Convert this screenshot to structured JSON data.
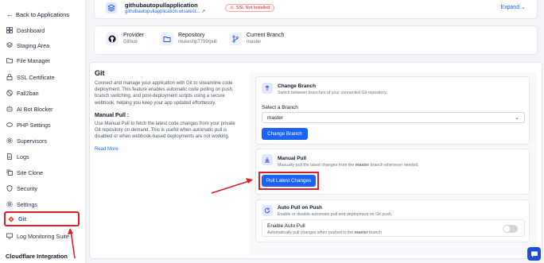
{
  "sidebar": {
    "back_label": "Back to Applications",
    "items": [
      {
        "label": "Dashboard",
        "icon": "dashboard-icon"
      },
      {
        "label": "Staging Area",
        "icon": "layers-icon"
      },
      {
        "label": "File Manager",
        "icon": "folder-icon"
      },
      {
        "label": "SSL Certificate",
        "icon": "lock-icon"
      },
      {
        "label": "Fail2ban",
        "icon": "ban-icon"
      },
      {
        "label": "AI Bot Blocker",
        "icon": "robot-icon"
      },
      {
        "label": "PHP Settings",
        "icon": "php-icon"
      },
      {
        "label": "Supervisors",
        "icon": "gear-icon"
      },
      {
        "label": "Logs",
        "icon": "document-icon"
      },
      {
        "label": "Site Clone",
        "icon": "copy-icon"
      },
      {
        "label": "Security",
        "icon": "shield-icon"
      },
      {
        "label": "Settings",
        "icon": "gear-icon"
      },
      {
        "label": "Git",
        "icon": "git-icon",
        "active": true
      },
      {
        "label": "Log Monitoring Suite",
        "icon": "monitor-icon"
      }
    ],
    "footer_label": "Cloudflare Integration"
  },
  "app": {
    "name": "githubautopullapplication",
    "url": "githubautopullapplication.wlsatest...",
    "ssl_badge": "SSL Not Installed",
    "expand_label": "Expand"
  },
  "repo": {
    "provider_label": "Provider",
    "provider_value": "Github",
    "repository_label": "Repository",
    "repository_value": "mukeshp7799/pull",
    "branch_label": "Current Branch",
    "branch_value": "master"
  },
  "git": {
    "title": "Git",
    "description": "Connect and manage your application with Git to streamline code deployment. This feature enables automatic code pulling on push, branch switching, and post-deployment scripts using a secure webhook, helping you keep your app updated effortlessly.",
    "manual_title": "Manual Pull :",
    "manual_description": "Use Manual Pull to fetch the latest code changes from your private Git repository on demand. This is useful when automatic pull is disabled or when webhook-based deployments are not working.",
    "read_more": "Read More"
  },
  "change_branch": {
    "title": "Change Branch",
    "subtitle": "Switch between branches of your connected Git repository.",
    "select_label": "Select a Branch",
    "selected_branch": "master",
    "button_label": "Change Branch"
  },
  "manual_pull": {
    "title": "Manual Pull",
    "subtitle_prefix": "Manually pull the latest changes from the ",
    "subtitle_branch": "master",
    "subtitle_suffix": " branch whenever needed.",
    "button_label": "Pull Latest Changes"
  },
  "auto_pull": {
    "title": "Auto Pull on Push",
    "subtitle": "Enable or disable automatic pull and deployment on Git push.",
    "toggle_title": "Enable Auto Pull",
    "toggle_subtitle_prefix": "Automatically pull changes when pushed to the ",
    "toggle_subtitle_branch": "master",
    "toggle_subtitle_suffix": " branch",
    "enabled": false
  },
  "colors": {
    "accent": "#1d64f2",
    "highlight": "#e11d2a",
    "link": "#2563eb"
  }
}
